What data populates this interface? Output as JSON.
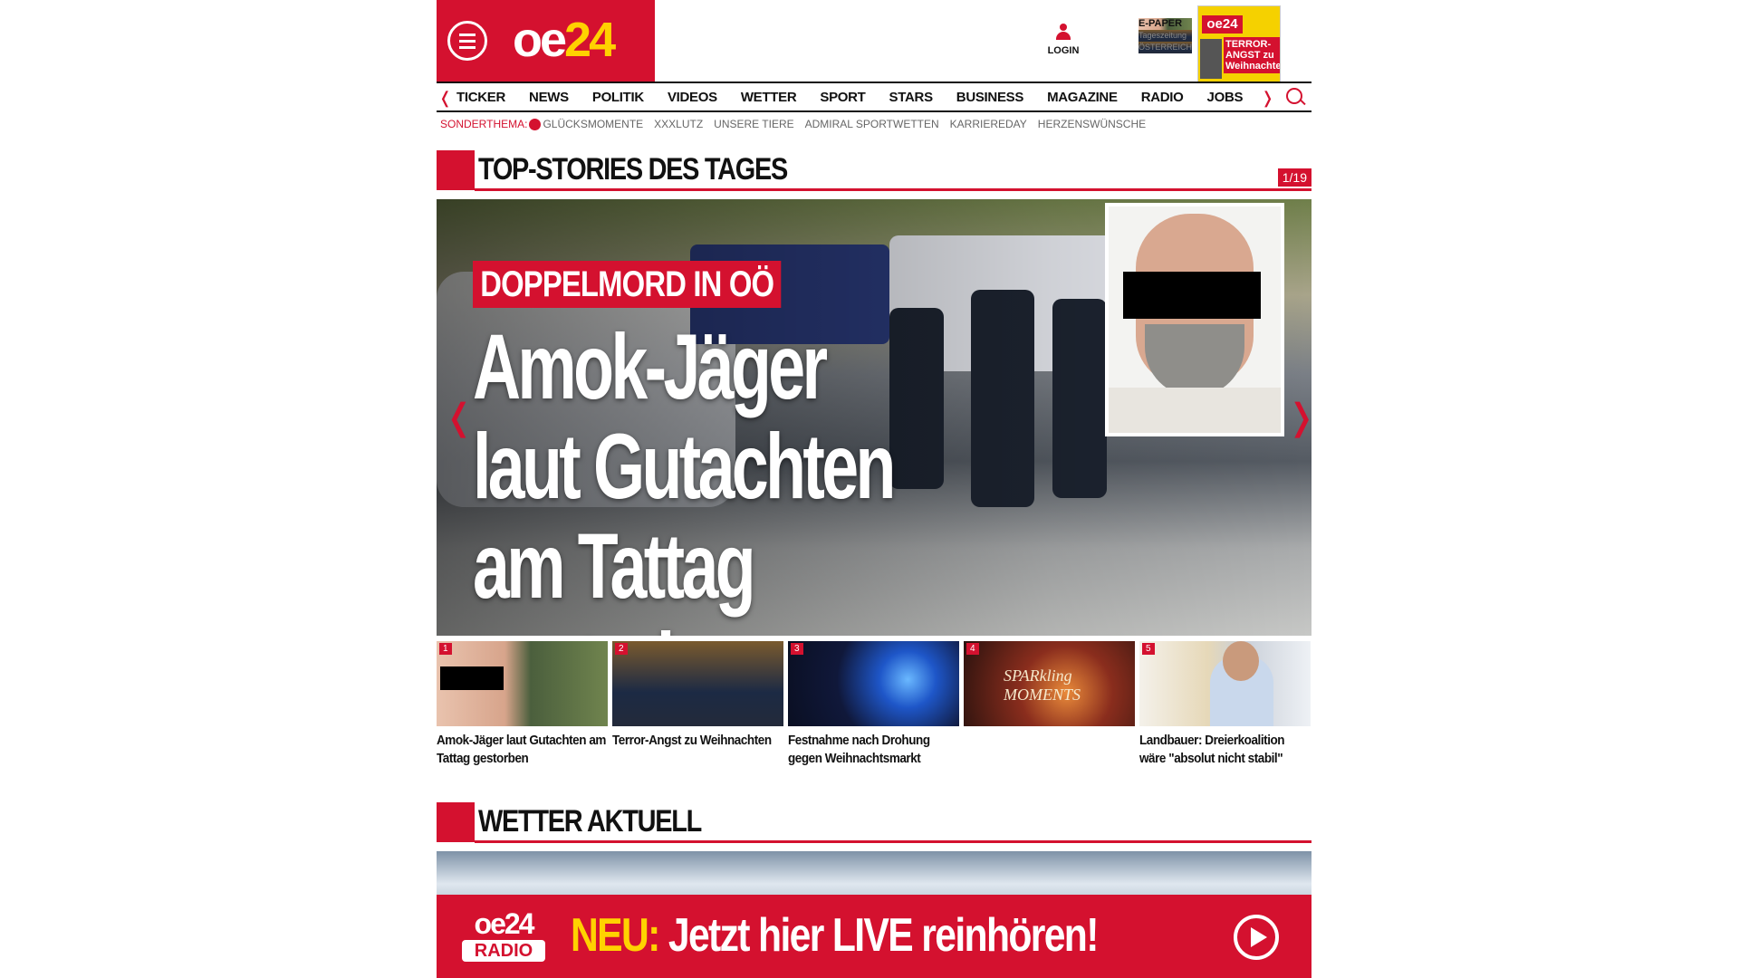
{
  "header": {
    "logo_oe": "oe",
    "logo_24": "24",
    "login_label": "LOGIN",
    "epaper": {
      "title": "E-PAPER",
      "line1": "Tageszeitung",
      "line2": "ÖSTERREICH",
      "cover_masthead": "oe24",
      "cover_headline": "TERROR-ANGST zu Weihnachten"
    }
  },
  "nav": {
    "items": [
      "TICKER",
      "NEWS",
      "POLITIK",
      "VIDEOS",
      "WETTER",
      "SPORT",
      "STARS",
      "BUSINESS",
      "MAGAZINE",
      "RADIO",
      "JOBS"
    ]
  },
  "subnav": {
    "sonder_label": "SONDERTHEMA:",
    "items": [
      "GLÜCKSMOMENTE",
      "XXXLUTZ",
      "UNSERE TIERE",
      "ADMIRAL SPORTWETTEN",
      "KARRIEREDAY",
      "HERZENSWÜNSCHE"
    ]
  },
  "top_stories": {
    "title": "TOP-STORIES DES TAGES",
    "counter": "1/19",
    "hero": {
      "kicker": "DOPPELMORD IN OÖ",
      "headline": "Amok-Jäger laut Gutachten am Tattag gestorben"
    },
    "thumbs": [
      {
        "num": "1",
        "caption": "Amok-Jäger laut Gutachten am Tattag gestorben"
      },
      {
        "num": "2",
        "caption": "Terror-Angst zu Weihnachten"
      },
      {
        "num": "3",
        "caption": "Festnahme nach Drohung gegen Weihnachtsmarkt"
      },
      {
        "num": "4",
        "caption": "",
        "image_text": "SPARkling MOMENTS"
      },
      {
        "num": "5",
        "caption": "Landbauer: Dreierkoalition wäre \"absolut nicht stabil\""
      }
    ]
  },
  "weather": {
    "title": "WETTER AKTUELL"
  },
  "radio_banner": {
    "logo_top": "oe24",
    "logo_bottom": "RADIO",
    "neu": "NEU:",
    "text": "Jetzt hier LIVE reinhören!"
  },
  "colors": {
    "brand_red": "#d4112f",
    "brand_yellow": "#ffd200"
  }
}
